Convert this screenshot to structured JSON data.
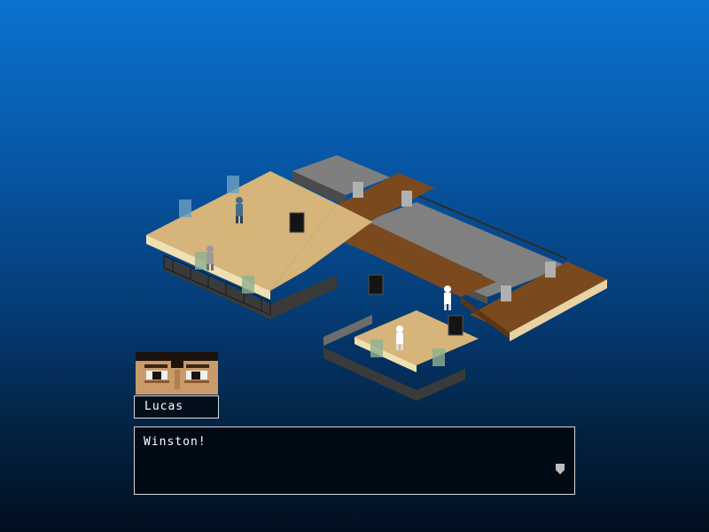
{
  "game": {
    "speaker": "Lucas",
    "dialogue": "Winston!",
    "advance_indicator": "advance-arrow-icon"
  },
  "colors": {
    "background_top": "#0a73cf",
    "background_bottom": "#010f1f",
    "floor_tan": "#d7b47a",
    "floor_wood": "#7a4a1e",
    "floor_concrete": "#8a8a8a",
    "dialog_bg": "#010b16",
    "dialog_border": "#d8d8d8"
  }
}
